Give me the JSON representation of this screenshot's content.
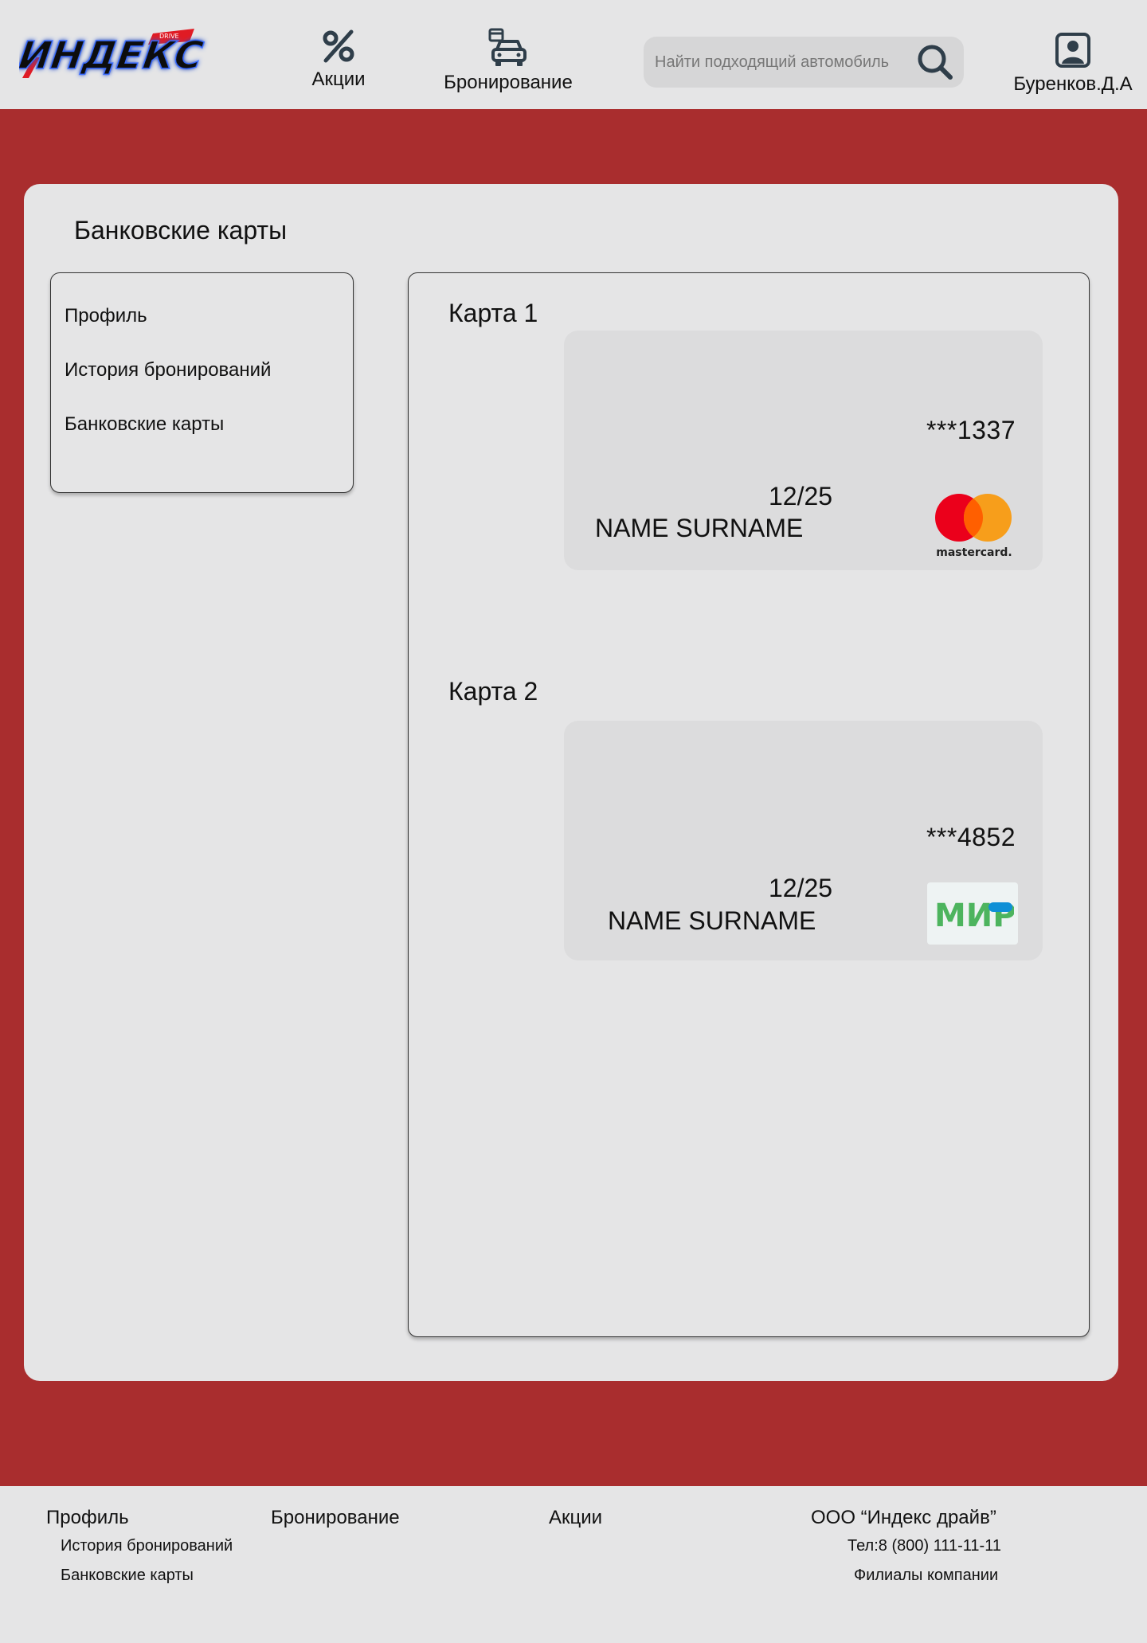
{
  "header": {
    "logo_text": "ИНДЕКС",
    "logo_subtext": "DRIVE",
    "nav": {
      "promo_label": "Акции",
      "booking_label": "Бронирование"
    },
    "search": {
      "placeholder": "Найти подходящий автомобиль",
      "icon": "search-icon"
    },
    "user": {
      "name": "Буренков.Д.А",
      "icon": "user-profile-icon"
    }
  },
  "page": {
    "title": "Банковские карты"
  },
  "sidebar": {
    "items": [
      {
        "label": "Профиль"
      },
      {
        "label": "История бронирований"
      },
      {
        "label": "Банковские карты"
      }
    ]
  },
  "cards": [
    {
      "label": "Карта 1",
      "number": "***1337",
      "expiry": "12/25",
      "holder": "NAME SURNAME",
      "brand": "mastercard",
      "brand_text": "mastercard."
    },
    {
      "label": "Карта 2",
      "number": "***4852",
      "expiry": "12/25",
      "holder": "NAME SURNAME",
      "brand": "mir",
      "brand_text": "МИР"
    }
  ],
  "footer": {
    "col1": {
      "title": "Профиль",
      "links": [
        "История бронирований",
        "Банковские карты"
      ]
    },
    "col2": {
      "title": "Бронирование"
    },
    "col3": {
      "title": "Акции"
    },
    "col4": {
      "title": "ООО “Индекс драйв”",
      "phone": "Тел:8 (800) 111-11-11",
      "branches": "Филиалы компании"
    }
  },
  "colors": {
    "background_red": "#a92d2e",
    "panel": "#e5e5e6",
    "card": "#dcdcdd",
    "icon": "#2f3e4a",
    "mastercard_red": "#eb001b",
    "mastercard_orange": "#f79e1b",
    "mir_green": "#4db45e",
    "mir_blue": "#0f8fd6"
  }
}
